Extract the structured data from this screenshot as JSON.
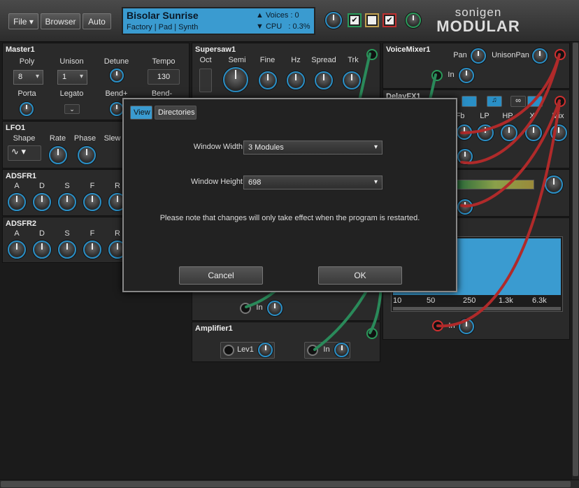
{
  "toolbar": {
    "file": "File",
    "browser": "Browser",
    "auto": "Auto"
  },
  "preset": {
    "name": "Bisolar Sunrise",
    "category": "Factory | Pad | Synth",
    "voices_label": "Voices",
    "voices_value": ": 0",
    "cpu_label": "CPU",
    "cpu_value": ": 0.3%"
  },
  "logo": {
    "top": "sonigen",
    "bottom": "MODULAR"
  },
  "master": {
    "title": "Master1",
    "poly_label": "Poly",
    "poly_value": "8",
    "unison_label": "Unison",
    "unison_value": "1",
    "detune_label": "Detune",
    "tempo_label": "Tempo",
    "tempo_value": "130",
    "porta_label": "Porta",
    "legato_label": "Legato",
    "bend_up_label": "Bend+",
    "bend_down_label": "Bend-"
  },
  "lfo": {
    "title": "LFO1",
    "shape": "Shape",
    "rate": "Rate",
    "phase": "Phase",
    "slew": "Slew"
  },
  "adsfr1": {
    "title": "ADSFR1",
    "labels": [
      "A",
      "D",
      "S",
      "F",
      "R"
    ]
  },
  "adsfr2": {
    "title": "ADSFR2",
    "labels": [
      "A",
      "D",
      "S",
      "F",
      "R"
    ]
  },
  "supersaw": {
    "title": "Supersaw1",
    "oct": "Oct",
    "semi": "Semi",
    "fine": "Fine",
    "hz": "Hz",
    "spread": "Spread",
    "trk": "Trk"
  },
  "amp": {
    "title": "Amplifier1",
    "lev": "Lev1",
    "in": "In"
  },
  "voicemixer": {
    "title": "VoiceMixer1",
    "pan": "Pan",
    "unisonpan": "UnisonPan",
    "in": "In"
  },
  "delay": {
    "title": "DelayFX1",
    "fb": "Fb",
    "lp": "LP",
    "hp": "HP",
    "x": "X",
    "mix": "Mix"
  },
  "eq": {
    "ticks": [
      "10",
      "50",
      "250",
      "1.3k",
      "6.3k"
    ],
    "in": "In"
  },
  "misc": {
    "in": "In"
  },
  "dialog": {
    "tab_view": "View",
    "tab_directories": "Directories",
    "width_label": "Window Width",
    "width_value": "3 Modules",
    "height_label": "Window Height",
    "height_value": "698",
    "note": "Please note that changes will only take effect when the program is restarted.",
    "cancel": "Cancel",
    "ok": "OK"
  },
  "colors": {
    "accent": "#2a8fc6",
    "lcd": "#3a9bd0",
    "cable_red": "#b02a2a",
    "cable_green": "#2a8a5a"
  }
}
